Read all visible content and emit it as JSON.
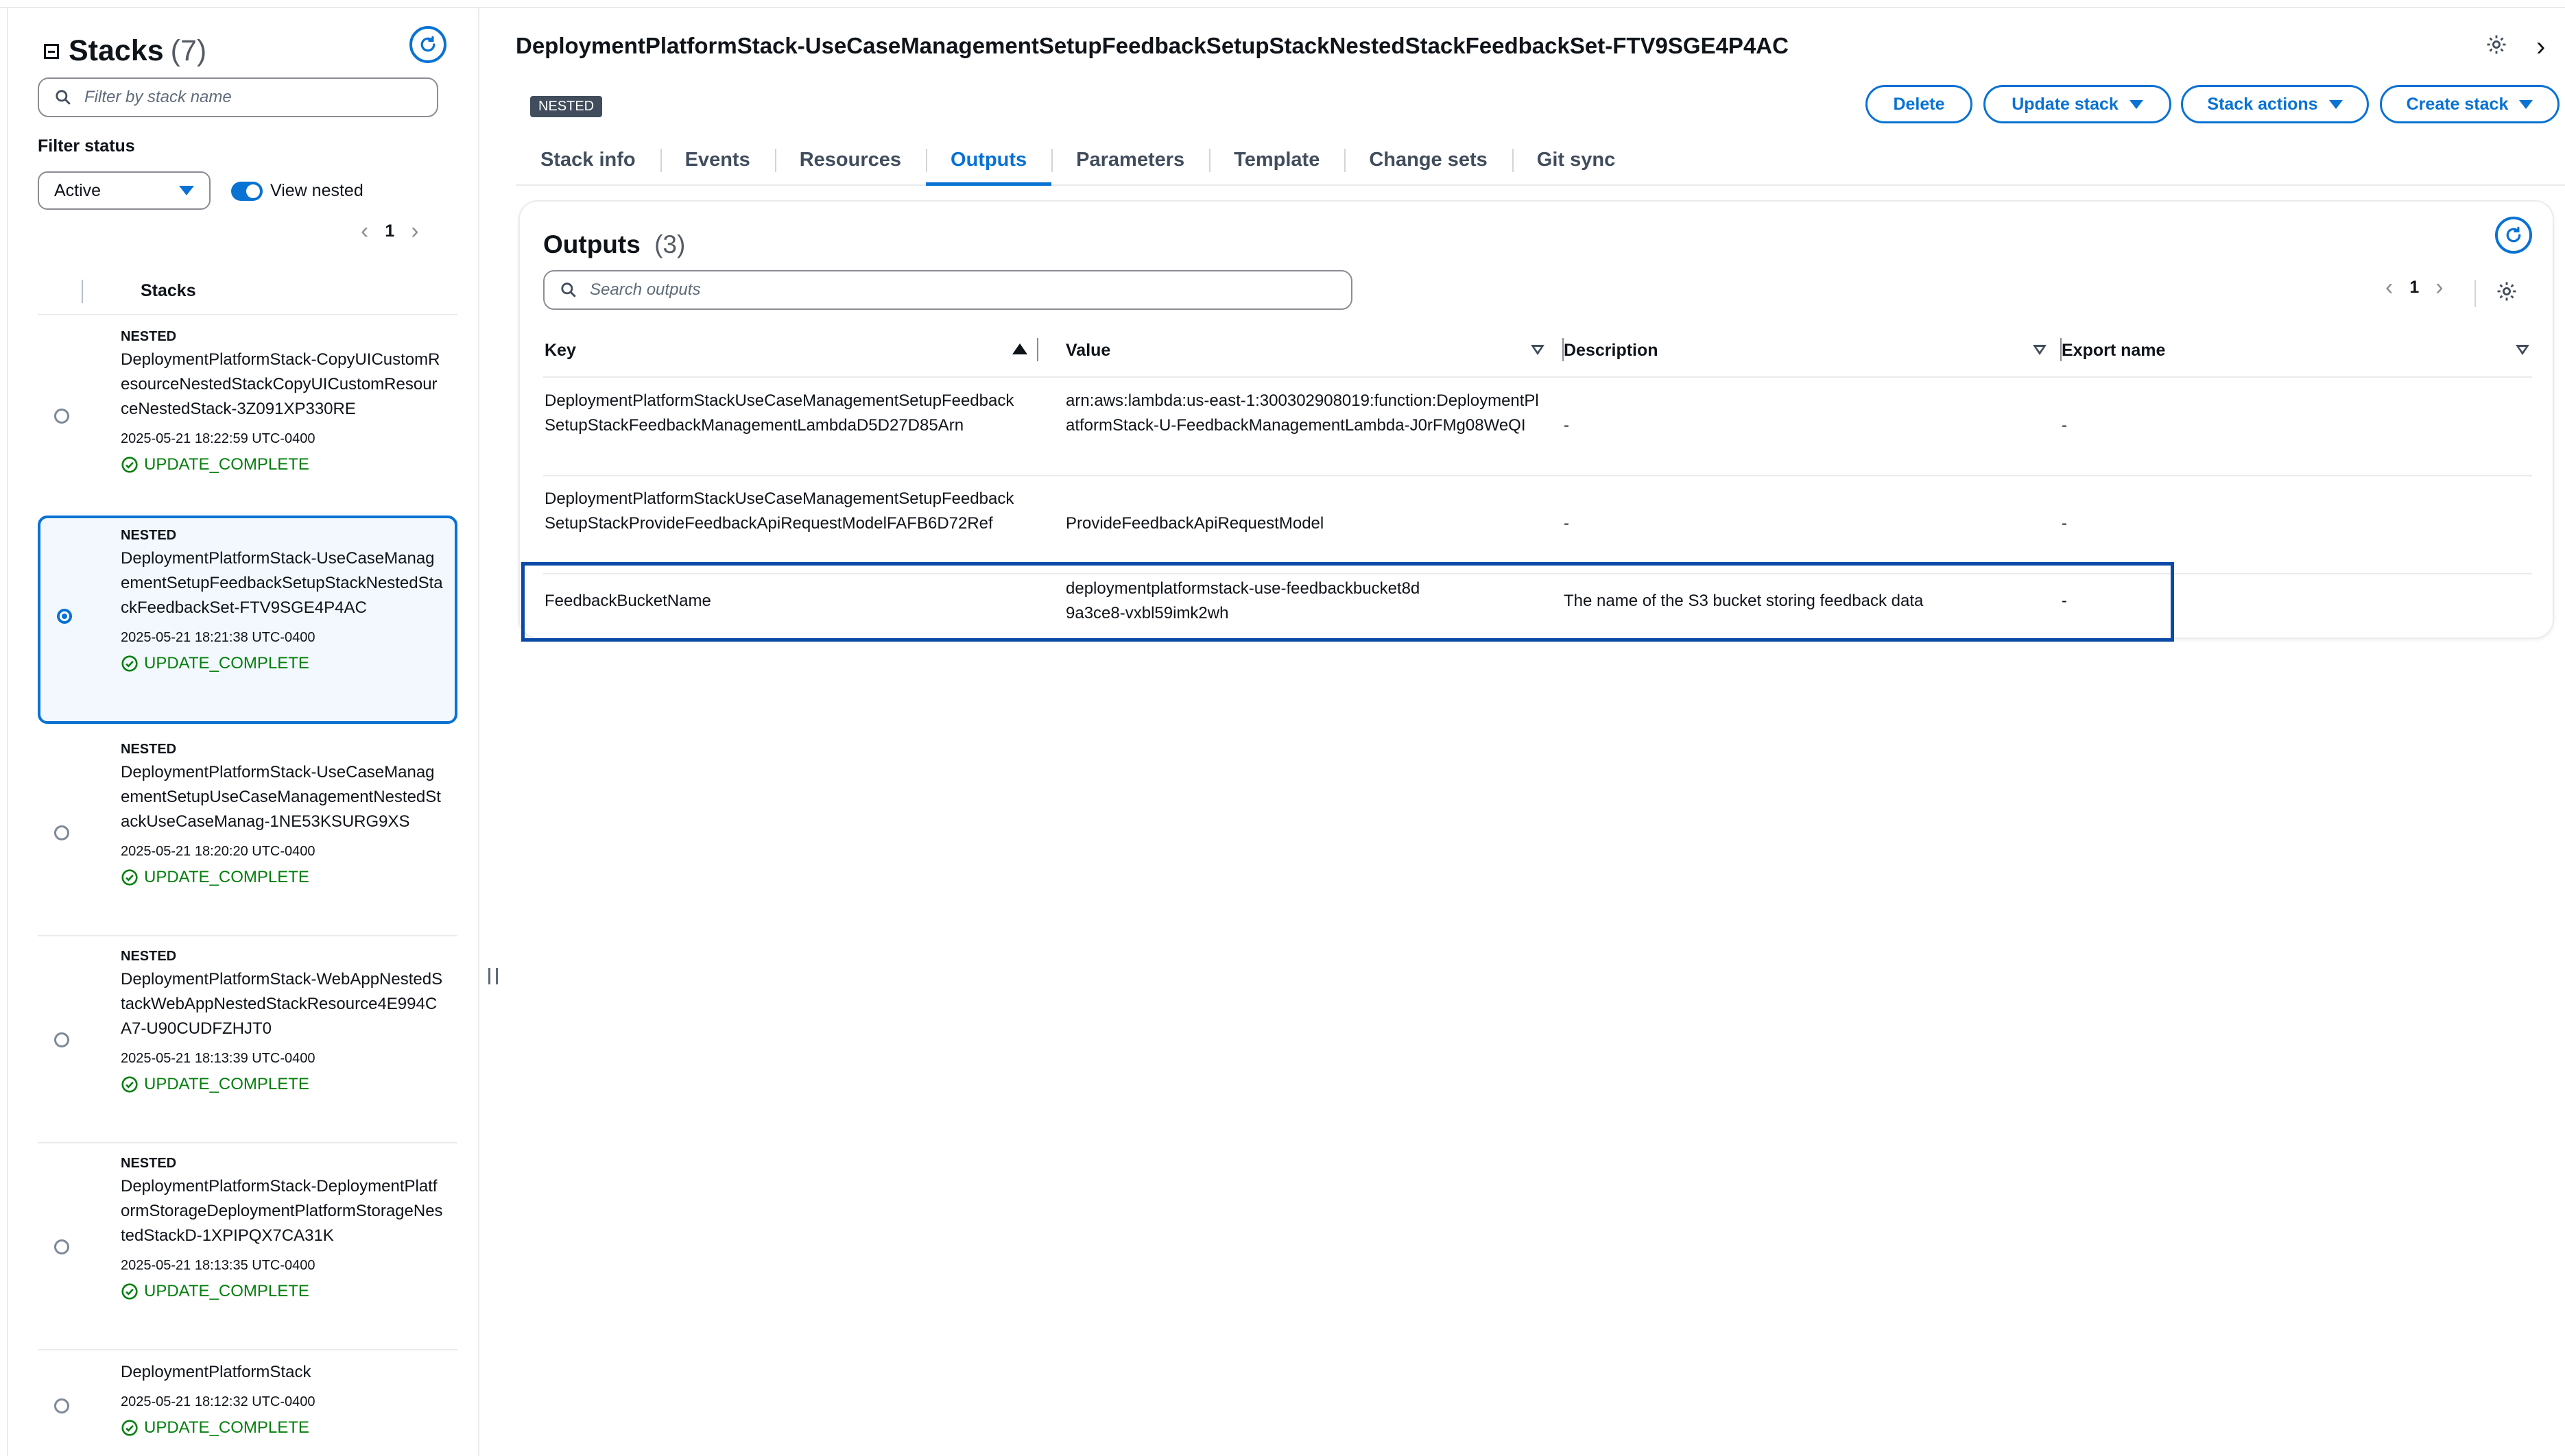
{
  "sidebar": {
    "title": "Stacks",
    "count": "(7)",
    "filter_placeholder": "Filter by stack name",
    "filter_status_label": "Filter status",
    "filter_status_value": "Active",
    "view_nested_label": "View nested",
    "view_nested_on": true,
    "page": "1",
    "column_header": "Stacks",
    "stacks": [
      {
        "tag": "NESTED",
        "name": "DeploymentPlatformStack-CopyUICustomResourceNestedStackCopyUICustomResourceNestedStack-3Z091XP330RE",
        "date": "2025-05-21 18:22:59 UTC-0400",
        "status": "UPDATE_COMPLETE",
        "selected": false
      },
      {
        "tag": "NESTED",
        "name": "DeploymentPlatformStack-UseCaseManagementSetupFeedbackSetupStackNestedStackFeedbackSet-FTV9SGE4P4AC",
        "date": "2025-05-21 18:21:38 UTC-0400",
        "status": "UPDATE_COMPLETE",
        "selected": true
      },
      {
        "tag": "NESTED",
        "name": "DeploymentPlatformStack-UseCaseManagementSetupUseCaseManagementNestedStackUseCaseManag-1NE53KSURG9XS",
        "date": "2025-05-21 18:20:20 UTC-0400",
        "status": "UPDATE_COMPLETE",
        "selected": false
      },
      {
        "tag": "NESTED",
        "name": "DeploymentPlatformStack-WebAppNestedStackWebAppNestedStackResource4E994CA7-U90CUDFZHJT0",
        "date": "2025-05-21 18:13:39 UTC-0400",
        "status": "UPDATE_COMPLETE",
        "selected": false
      },
      {
        "tag": "NESTED",
        "name": "DeploymentPlatformStack-DeploymentPlatformStorageDeploymentPlatformStorageNestedStackD-1XPIPQX7CA31K",
        "date": "2025-05-21 18:13:35 UTC-0400",
        "status": "UPDATE_COMPLETE",
        "selected": false
      },
      {
        "tag": "",
        "name": "DeploymentPlatformStack",
        "date": "2025-05-21 18:12:32 UTC-0400",
        "status": "UPDATE_COMPLETE",
        "selected": false
      }
    ]
  },
  "main": {
    "title": "DeploymentPlatformStack-UseCaseManagementSetupFeedbackSetupStackNestedStackFeedbackSet-FTV9SGE4P4AC",
    "badge": "NESTED",
    "buttons": {
      "delete": "Delete",
      "update": "Update stack",
      "actions": "Stack actions",
      "create": "Create stack"
    },
    "tabs": [
      "Stack info",
      "Events",
      "Resources",
      "Outputs",
      "Parameters",
      "Template",
      "Change sets",
      "Git sync"
    ],
    "active_tab": "Outputs",
    "outputs": {
      "title": "Outputs",
      "count": "(3)",
      "search_placeholder": "Search outputs",
      "page": "1",
      "columns": [
        "Key",
        "Value",
        "Description",
        "Export name"
      ],
      "rows": [
        {
          "key": "DeploymentPlatformStackUseCaseManagementSetupFeedbackSetupStackFeedbackManagementLambdaD5D27D85Arn",
          "value": "arn:aws:lambda:us-east-1:300302908019:function:DeploymentPlatformStack-U-FeedbackManagementLambda-J0rFMg08WeQI",
          "description": "-",
          "export": "-"
        },
        {
          "key": "DeploymentPlatformStackUseCaseManagementSetupFeedbackSetupStackProvideFeedbackApiRequestModelFAFB6D72Ref",
          "value": "ProvideFeedbackApiRequestModel",
          "description": "-",
          "export": "-"
        },
        {
          "key": "FeedbackBucketName",
          "value": "deploymentplatformstack-use-feedbackbucket8d9a3ce8-vxbl59imk2wh",
          "description": "The name of the S3 bucket storing feedback data",
          "export": "-"
        }
      ]
    }
  },
  "colors": {
    "accent": "#0972d3",
    "success": "#037f0c",
    "highlight": "#0a49a8"
  },
  "icons": [
    "collapse-icon",
    "refresh-icon",
    "search-icon",
    "caret-down-icon",
    "chevron-left-icon",
    "chevron-right-icon",
    "check-circle-icon",
    "gear-icon",
    "sort-ascending-icon",
    "sort-descending-icon",
    "resize-handle-icon"
  ]
}
